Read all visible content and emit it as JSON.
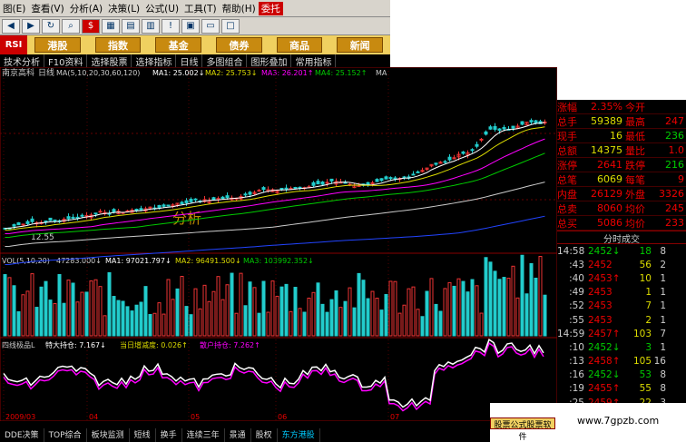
{
  "menu": [
    "图(E)",
    "查看(V)",
    "分析(A)",
    "决策(L)",
    "公式(U)",
    "工具(T)",
    "帮助(H)",
    "委托"
  ],
  "market_buttons": [
    "港股",
    "指数",
    "基金",
    "债券",
    "商品",
    "新闻"
  ],
  "rsi": "RSI",
  "tabs": [
    "技术分析",
    "F10资料",
    "选择股票",
    "选择指标",
    "日线",
    "多图组合",
    "图形叠加",
    "常用指标"
  ],
  "stock_label": "南京高科",
  "period_label": "日线",
  "ma_line": {
    "param": "MA(5,10,20,30,60,120)",
    "ma1": "MA1: 25.002↓",
    "ma2": "MA2: 25.753↓",
    "ma3": "MA3: 26.201↑",
    "ma4": "MA4: 25.152↑",
    "ma5": "MA"
  },
  "low_label": "12.55",
  "vol_line": {
    "param": "VOL(5,10,20)",
    "v": "47283.000↓",
    "ma1": "MA1: 97021.797↓",
    "ma2": "MA2: 96491.500↓",
    "ma3": "MA3: 103992.352↓"
  },
  "ind_line": {
    "name": "四线极品L",
    "a": "特大持仓: 7.167↓",
    "b": "当日增减度: 0.026↑",
    "c": "散户持仓: 7.262↑"
  },
  "date_axis": [
    "2009/03",
    "04",
    "05",
    "06",
    "07"
  ],
  "quotes": [
    {
      "k": "涨幅",
      "v": "2.35%",
      "k2": "今开",
      "v2": ""
    },
    {
      "k": "总手",
      "v": "59389",
      "k2": "最高",
      "v2": "247"
    },
    {
      "k": "现手",
      "v": "16",
      "k2": "最低",
      "v2": "236"
    },
    {
      "k": "总额",
      "v": "14375",
      "k2": "量比",
      "v2": "1.0"
    },
    {
      "k": "涨停",
      "v": "2641",
      "k2": "跌停",
      "v2": "216"
    },
    {
      "k": "总笔",
      "v": "6069",
      "k2": "每笔",
      "v2": "9"
    },
    {
      "k": "内盘",
      "v": "26129",
      "k2": "外盘",
      "v2": "3326"
    },
    {
      "k": "总卖",
      "v": "8060",
      "k2": "均价",
      "v2": "245"
    },
    {
      "k": "总买",
      "v": "5086",
      "k2": "均价",
      "v2": "233"
    }
  ],
  "trade_header": "分时成交",
  "trades": [
    {
      "t": "14:58",
      "p": "2452",
      "d": "↓",
      "v": "18",
      "r": "8"
    },
    {
      "t": ":43",
      "p": "2452",
      "d": "",
      "v": "56",
      "r": "2"
    },
    {
      "t": ":40",
      "p": "2453",
      "d": "↑",
      "v": "10",
      "r": "1"
    },
    {
      "t": ":49",
      "p": "2453",
      "d": "",
      "v": "1",
      "r": "1"
    },
    {
      "t": ":52",
      "p": "2453",
      "d": "",
      "v": "7",
      "r": "1"
    },
    {
      "t": ":55",
      "p": "2453",
      "d": "",
      "v": "2",
      "r": "1"
    },
    {
      "t": "14:59",
      "p": "2457",
      "d": "↑",
      "v": "103",
      "r": "7"
    },
    {
      "t": ":10",
      "p": "2452",
      "d": "↓",
      "v": "3",
      "r": "1"
    },
    {
      "t": ":13",
      "p": "2458",
      "d": "↑",
      "v": "105",
      "r": "16"
    },
    {
      "t": ":16",
      "p": "2452",
      "d": "↓",
      "v": "53",
      "r": "8"
    },
    {
      "t": ":19",
      "p": "2455",
      "d": "↑",
      "v": "55",
      "r": "8"
    },
    {
      "t": ":25",
      "p": "2459",
      "d": "↑",
      "v": "22",
      "r": "3"
    }
  ],
  "bottom_tabs": [
    "DDE决策",
    "TOP综合",
    "板块监测",
    "短线",
    "换手",
    "连续三年",
    "景通",
    "股权",
    "东方港股"
  ],
  "ad_text": "股票公式股票软件",
  "watermark": "www.7gpzb.com",
  "big_text": "分析"
}
